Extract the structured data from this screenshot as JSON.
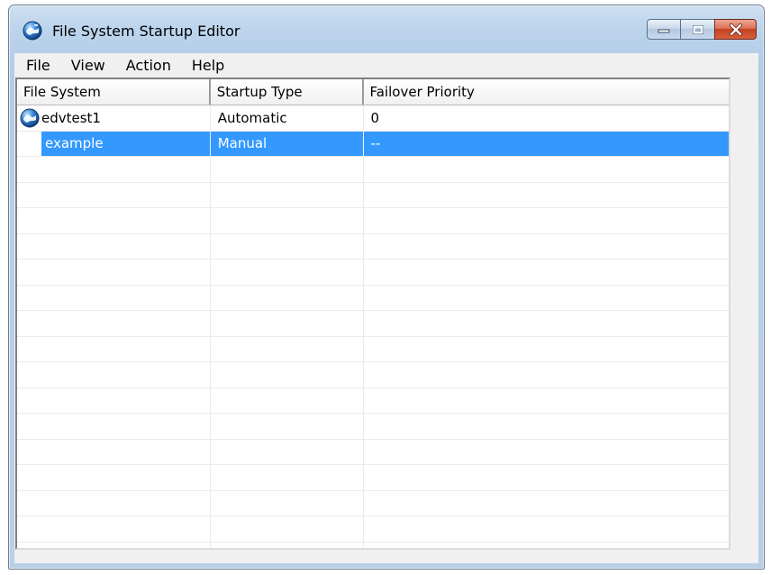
{
  "window": {
    "title": "File System Startup Editor"
  },
  "menu": [
    "File",
    "View",
    "Action",
    "Help"
  ],
  "table": {
    "columns": [
      "File System",
      "Startup Type",
      "Failover Priority"
    ],
    "rows": [
      {
        "name": "edvtest1",
        "startup": "Automatic",
        "priority": "0",
        "icon": "globe-icon",
        "selected": false
      },
      {
        "name": "example",
        "startup": "Manual",
        "priority": "--",
        "icon": "",
        "selected": true
      }
    ]
  },
  "colors": {
    "selection": "#3399ff",
    "close_button": "#c2421f"
  }
}
